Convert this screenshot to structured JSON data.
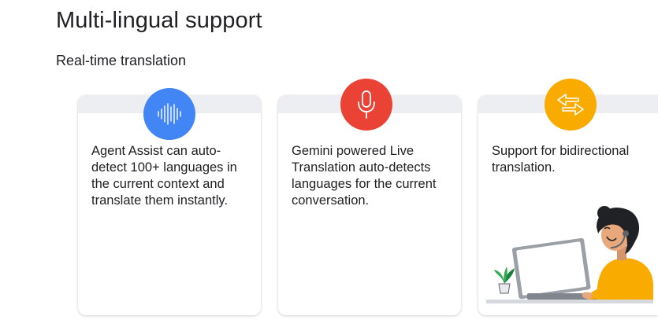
{
  "header": {
    "title": "Multi-lingual support",
    "subtitle": "Real-time translation"
  },
  "cards": [
    {
      "text": "Agent Assist can auto-detect 100+ languages in the current context and translate them instantly.",
      "icon": "audio-waveform-icon",
      "icon_color": "#4285f4"
    },
    {
      "text": "Gemini powered Live Translation auto-detects languages for the current conversation.",
      "icon": "microphone-icon",
      "icon_color": "#ea4335"
    },
    {
      "text": "Support for bidirectional translation.",
      "icon": "swap-arrows-icon",
      "icon_color": "#f9ab00",
      "illustration": "agent-at-laptop-illustration"
    }
  ]
}
